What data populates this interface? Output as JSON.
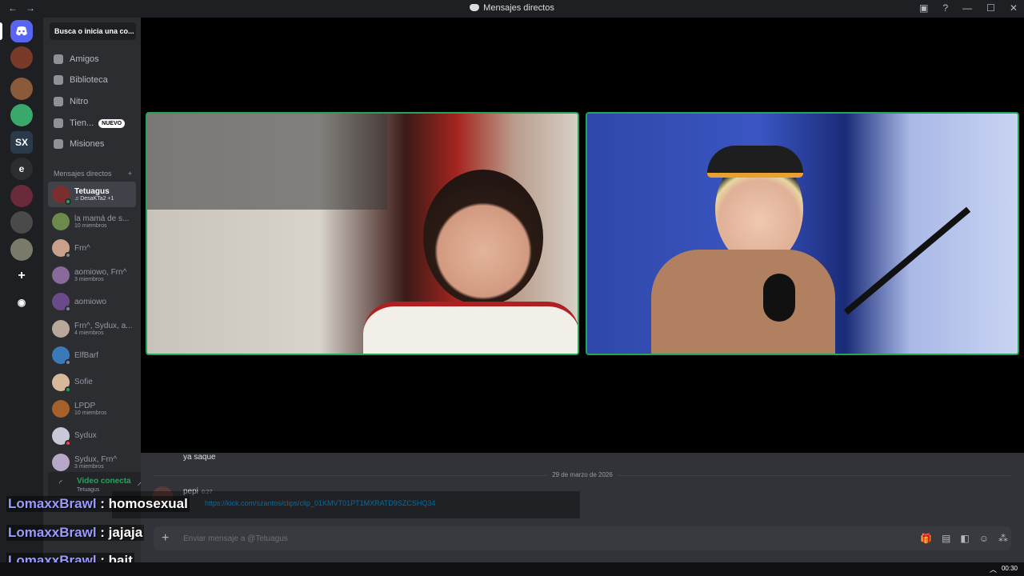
{
  "titlebar": {
    "title": "Mensajes directos",
    "back": "←",
    "forward": "→",
    "minimize": "—",
    "maximize": "☐",
    "close": "✕",
    "inbox_icon": "▣",
    "help_icon": "?"
  },
  "servers": [
    {
      "label": "",
      "kind": "home"
    },
    {
      "label": "",
      "kind": "avatar"
    },
    {
      "label": "",
      "kind": "avatar"
    },
    {
      "label": "",
      "kind": "avatar"
    },
    {
      "label": "SX",
      "kind": "text"
    },
    {
      "label": "e",
      "kind": "text"
    },
    {
      "label": "",
      "kind": "avatar"
    },
    {
      "label": "",
      "kind": "avatar"
    },
    {
      "label": "",
      "kind": "avatar"
    },
    {
      "label": "+",
      "kind": "add"
    },
    {
      "label": "◉",
      "kind": "add"
    }
  ],
  "search": {
    "placeholder": "Busca o inicia una co..."
  },
  "nav": [
    {
      "label": "Amigos"
    },
    {
      "label": "Biblioteca"
    },
    {
      "label": "Nitro"
    },
    {
      "label": "Tien...",
      "badge": "NUEVO"
    },
    {
      "label": "Misiones"
    }
  ],
  "dm_header": {
    "label": "Mensajes directos",
    "add": "+"
  },
  "dms": [
    {
      "name": "Tetuagus",
      "sub": "♫ DesaKTa2 +1",
      "color": "#7a2e2e",
      "status": "#23a559"
    },
    {
      "name": "la mamá de s...",
      "sub": "10 miembros",
      "color": "#6b8a4b",
      "status": ""
    },
    {
      "name": "Frn^",
      "sub": "",
      "color": "#c9a08a",
      "status": "#80848e"
    },
    {
      "name": "aomiowo, Frn^",
      "sub": "3 miembros",
      "color": "#8a6a9a",
      "status": ""
    },
    {
      "name": "aomiowo",
      "sub": "",
      "color": "#6a4a8a",
      "status": "#80848e"
    },
    {
      "name": "Frn^, Sydux, a...",
      "sub": "4 miembros",
      "color": "#b8a89a",
      "status": ""
    },
    {
      "name": "ElfBarf",
      "sub": "",
      "color": "#3a7ab8",
      "status": "#80848e"
    },
    {
      "name": "Sofie",
      "sub": "",
      "color": "#d8b89a",
      "status": "#23a559"
    },
    {
      "name": "LPDP",
      "sub": "10 miembros",
      "color": "#a8602a",
      "status": ""
    },
    {
      "name": "Sydux",
      "sub": "",
      "color": "#c8c8d8",
      "status": "#f23f43"
    },
    {
      "name": "Sydux, Frn^",
      "sub": "3 miembros",
      "color": "#b8a8c8",
      "status": ""
    }
  ],
  "voice": {
    "status": "Video conecta",
    "channel": "Tetuagus"
  },
  "chat": {
    "prev_message": "ya saque",
    "date": "29 de marzo de 2026",
    "author": "pepi",
    "time": "0:27",
    "link": "https://kick.com/szantos/clips/clip_01KMVT01PT1MXRATD9SZCSHQ34",
    "composer_placeholder": "Enviar mensaje a @Tetuagus",
    "composer_plus": "+"
  },
  "stream_chat": [
    {
      "user": "LomaxxBrawl",
      "text": ": homosexual"
    },
    {
      "user": "LomaxxBrawl",
      "text": ": jajaja"
    },
    {
      "user": "LomaxxBrawl",
      "text": ": bait"
    }
  ],
  "taskbar": {
    "clock": "00:30",
    "caret": "︿"
  },
  "colors": {
    "accent": "#5865f2",
    "speaking": "#23a559",
    "link": "#00a8fc",
    "sidebar": "#2b2d31",
    "rail": "#1e1f22"
  }
}
